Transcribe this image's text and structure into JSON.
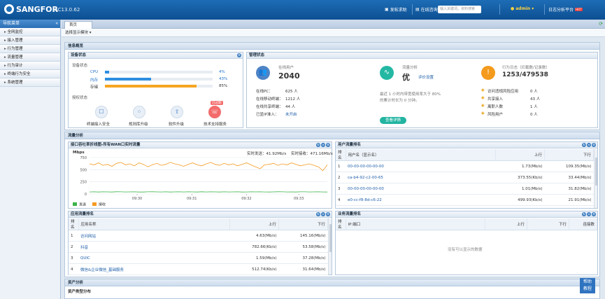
{
  "header": {
    "logo": "SANGFOR",
    "version": "AC13.0.62",
    "links": [
      "发帖求助",
      "在线咨询",
      "admin ▾",
      "日志分析平台"
    ],
    "search_placeholder": "输入关键词，资料搜索",
    "hot_badge": "HOT"
  },
  "nav": {
    "title": "导航菜单",
    "items": [
      "全网监控",
      "接入管理",
      "行为管理",
      "流量管理",
      "行为审计",
      "终端行为安全",
      "系统管理"
    ]
  },
  "tabs": [
    "首页"
  ],
  "subbar": "选择显示模块 ▾",
  "overview": {
    "title": "信息概览",
    "device": {
      "title": "设备状态",
      "resource_label": "设备状态",
      "bars": [
        {
          "name": "CPU",
          "value": "4%",
          "pct": 4
        },
        {
          "name": "内存",
          "value": "43%",
          "pct": 43
        },
        {
          "name": "存储",
          "value": "85%",
          "pct": 85
        }
      ],
      "license_label": "授权状态",
      "licenses": [
        "终端接入安全",
        "规则库升级",
        "软件升级",
        "技术支持服务"
      ],
      "expired_badge": "已过期"
    },
    "manage": {
      "title": "管理状态",
      "online_label": "在线用户",
      "online_value": "2040",
      "stats": [
        {
          "k": "在线PC：",
          "v": "625 人"
        },
        {
          "k": "在线移动终端：",
          "v": "1212 人"
        },
        {
          "k": "在线共享终端：",
          "v": "44 人"
        },
        {
          "k": "已显IP准入：",
          "v": "未开启"
        }
      ],
      "flow_label": "流量分析",
      "flow_grade": "优",
      "flow_link": "评价设置",
      "flow_desc1": "最近 1 小时内带宽使用率大于 80%",
      "flow_desc2": "的累计时长为 0 分钟。",
      "flow_btn": "查看详情",
      "log_label": "行为日志（拦截数/记录数）",
      "log_value": "1253/479538",
      "log_stats": [
        {
          "k": "访问违规风险应用",
          "v": "0 人"
        },
        {
          "k": "共享接入",
          "v": "43 人"
        },
        {
          "k": "离职人数",
          "v": "1 人"
        },
        {
          "k": "风险用户",
          "v": "0 人"
        }
      ]
    }
  },
  "traffic": {
    "title": "流量分析",
    "line_panel": {
      "title": "接口吞吐率折线图-所有WAN口实时流量",
      "unit": "Mbps",
      "send_label": "实时发送：41.92Mb/s",
      "recv_label": "实时接收：471.16Mb/s",
      "legend": [
        "发送",
        "接收"
      ],
      "colors": {
        "send": "#3cb34a",
        "recv": "#f59a23"
      }
    },
    "user_rank": {
      "title": "用户流量排名",
      "headers": [
        "排名",
        "用户名（显示名）",
        "上行",
        "下行"
      ],
      "rows": [
        [
          "1",
          "00-00-00-00-00-00",
          "1.73(Mb/s)",
          "109.35(Mb/s)"
        ],
        [
          "2",
          "ca-b4-92-c2-00-65",
          "373.55(Kb/s)",
          "33.44(Mb/s)"
        ],
        [
          "3",
          "00-00-00-00-00-00",
          "1.01(Mb/s)",
          "31.82(Mb/s)"
        ],
        [
          "4",
          "e0-cc-f8-8d-c6-22",
          "499.93(Kb/s)",
          "21.91(Mb/s)"
        ]
      ]
    },
    "app_rank": {
      "title": "应用流量排名",
      "headers": [
        "排名",
        "应用名称",
        "上行",
        "下行"
      ],
      "rows": [
        [
          "1",
          "访问网站",
          "4.63(Mb/s)",
          "145.16(Mb/s)"
        ],
        [
          "2",
          "抖音",
          "782.66(Kb/s)",
          "53.58(Mb/s)"
        ],
        [
          "3",
          "QUIC",
          "1.59(Mb/s)",
          "37.28(Mb/s)"
        ],
        [
          "4",
          "微信&企业微信_基础服务",
          "512.74(Kb/s)",
          "31.64(Mb/s)"
        ]
      ]
    },
    "biz_rank": {
      "title": "业务流量排名",
      "headers": [
        "排名",
        "IP:端口",
        "上行",
        "下行",
        "连接数"
      ],
      "empty": "没有可以显示的数据"
    }
  },
  "asset": {
    "title": "资产分析",
    "sub": "资产类型分布"
  },
  "help": [
    "帮助",
    "教程"
  ],
  "chart_data": {
    "type": "line",
    "x_ticks": [
      "09:30",
      "09:31",
      "09:32",
      "09:33"
    ],
    "y_ticks": [
      750,
      500,
      250,
      0
    ],
    "ylim": [
      0,
      750
    ],
    "ylabel": "Mbps",
    "series": [
      {
        "name": "接收",
        "values": [
          620,
          600,
          640,
          590,
          610,
          570,
          630,
          650,
          600,
          620,
          580,
          640,
          610,
          560,
          600,
          630,
          590,
          610,
          650,
          620,
          600,
          570,
          610,
          640,
          600,
          580,
          620,
          650,
          610,
          590,
          630,
          600,
          620,
          580,
          610,
          640,
          600,
          560,
          520,
          600,
          610,
          630,
          590,
          620,
          600,
          640,
          610,
          580,
          600,
          620,
          590,
          560,
          480,
          600
        ]
      },
      {
        "name": "发送",
        "values": [
          42,
          45,
          40,
          44,
          43,
          41,
          46,
          44,
          42,
          43,
          45,
          41,
          40,
          44,
          46,
          43,
          42,
          44,
          41,
          43,
          45,
          42,
          44,
          43,
          41,
          46,
          42,
          44,
          43,
          40,
          45,
          42,
          43,
          44,
          41,
          42,
          45,
          43,
          44,
          42,
          41,
          43,
          46,
          44,
          42,
          43,
          41,
          44,
          45,
          42,
          43,
          44,
          42,
          41
        ]
      }
    ]
  }
}
